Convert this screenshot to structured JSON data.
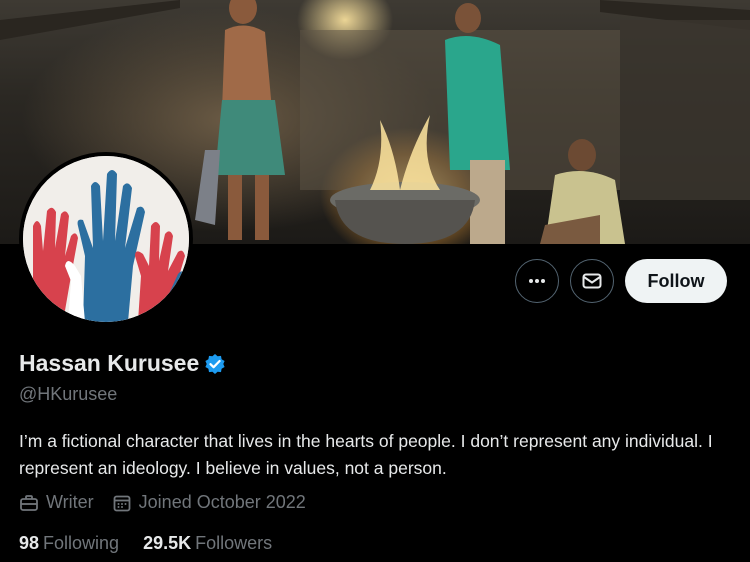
{
  "profile": {
    "name": "Hassan Kurusee",
    "handle": "@HKurusee",
    "bio": "I’m a fictional character that lives in the hearts of people. I don’t represent any individual. I represent an ideology. I believe in values, not a person.",
    "profession": "Writer",
    "joined": "Joined October 2022",
    "verified": true
  },
  "stats": {
    "following_count": "98",
    "following_label": "Following",
    "followers_count": "29.5K",
    "followers_label": "Followers"
  },
  "actions": {
    "more_icon": "more-icon",
    "message_icon": "envelope-icon",
    "follow_label": "Follow"
  },
  "colors": {
    "background": "#000000",
    "text": "#e7e9ea",
    "muted": "#71767b",
    "verified": "#1d9bf0",
    "follow_bg": "#eff3f4"
  }
}
